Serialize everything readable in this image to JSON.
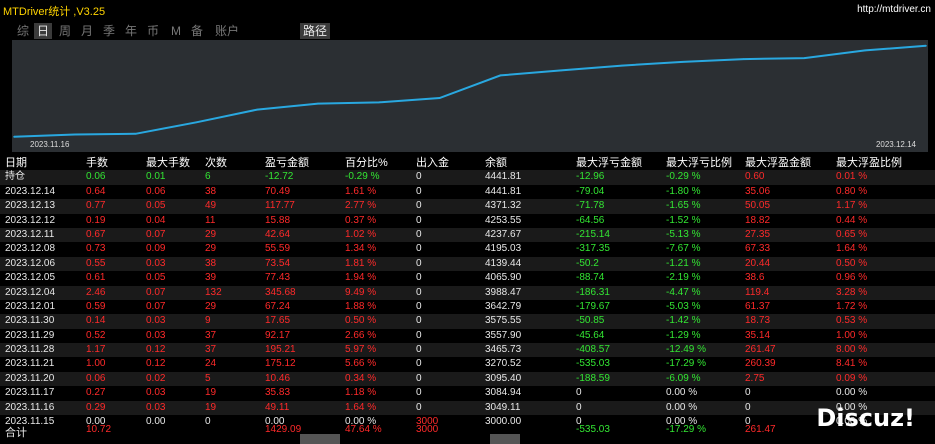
{
  "app": {
    "title": "MTDriver统计 ,V3.25",
    "url": "http://mtdriver.cn"
  },
  "tabs": [
    "综",
    "日",
    "周",
    "月",
    "季",
    "年",
    "币",
    "M",
    "备",
    "账户",
    "路径"
  ],
  "chart": {
    "date_start": "2023.11.16",
    "date_end": "2023.12.14",
    "line_color": "#29a8e0"
  },
  "chart_data": {
    "type": "line",
    "x": [
      "2023.11.16",
      "2023.11.17",
      "2023.11.20",
      "2023.11.21",
      "2023.11.28",
      "2023.11.29",
      "2023.11.30",
      "2023.12.01",
      "2023.12.04",
      "2023.12.05",
      "2023.12.06",
      "2023.12.08",
      "2023.12.11",
      "2023.12.12",
      "2023.12.13",
      "2023.12.14"
    ],
    "series": [
      {
        "values": [
          3049.11,
          3084.94,
          3095.4,
          3270.52,
          3465.73,
          3557.9,
          3575.55,
          3642.79,
          3988.47,
          4065.9,
          4139.44,
          4195.03,
          4237.67,
          4253.55,
          4371.32,
          4441.81
        ]
      }
    ],
    "ylim": [
      3000,
      4500
    ],
    "grid": false
  },
  "headers": [
    "日期",
    "手数",
    "最大手数",
    "次数",
    "盈亏金额",
    "百分比%",
    "出入金",
    "余额",
    "最大浮亏金额",
    "最大浮亏比例",
    "最大浮盈金额",
    "最大浮盈比例"
  ],
  "holding": [
    "持仓",
    "0.06",
    "0.01",
    "6",
    "-12.72",
    "-0.29 %",
    "0",
    "4441.81",
    "-12.96",
    "-0.29 %",
    "0.60",
    "0.01 %"
  ],
  "rows": [
    [
      "2023.12.14",
      "0.64",
      "0.06",
      "38",
      "70.49",
      "1.61 %",
      "0",
      "4441.81",
      "-79.04",
      "-1.80 %",
      "35.06",
      "0.80 %"
    ],
    [
      "2023.12.13",
      "0.77",
      "0.05",
      "49",
      "117.77",
      "2.77 %",
      "0",
      "4371.32",
      "-71.78",
      "-1.65 %",
      "50.05",
      "1.17 %"
    ],
    [
      "2023.12.12",
      "0.19",
      "0.04",
      "11",
      "15.88",
      "0.37 %",
      "0",
      "4253.55",
      "-64.56",
      "-1.52 %",
      "18.82",
      "0.44 %"
    ],
    [
      "2023.12.11",
      "0.67",
      "0.07",
      "29",
      "42.64",
      "1.02 %",
      "0",
      "4237.67",
      "-215.14",
      "-5.13 %",
      "27.35",
      "0.65 %"
    ],
    [
      "2023.12.08",
      "0.73",
      "0.09",
      "29",
      "55.59",
      "1.34 %",
      "0",
      "4195.03",
      "-317.35",
      "-7.67 %",
      "67.33",
      "1.64 %"
    ],
    [
      "2023.12.06",
      "0.55",
      "0.03",
      "38",
      "73.54",
      "1.81 %",
      "0",
      "4139.44",
      "-50.2",
      "-1.21 %",
      "20.44",
      "0.50 %"
    ],
    [
      "2023.12.05",
      "0.61",
      "0.05",
      "39",
      "77.43",
      "1.94 %",
      "0",
      "4065.90",
      "-88.74",
      "-2.19 %",
      "38.6",
      "0.96 %"
    ],
    [
      "2023.12.04",
      "2.46",
      "0.07",
      "132",
      "345.68",
      "9.49 %",
      "0",
      "3988.47",
      "-186.31",
      "-4.47 %",
      "119.4",
      "3.28 %"
    ],
    [
      "2023.12.01",
      "0.59",
      "0.07",
      "29",
      "67.24",
      "1.88 %",
      "0",
      "3642.79",
      "-179.67",
      "-5.03 %",
      "61.37",
      "1.72 %"
    ],
    [
      "2023.11.30",
      "0.14",
      "0.03",
      "9",
      "17.65",
      "0.50 %",
      "0",
      "3575.55",
      "-50.85",
      "-1.42 %",
      "18.73",
      "0.53 %"
    ],
    [
      "2023.11.29",
      "0.52",
      "0.03",
      "37",
      "92.17",
      "2.66 %",
      "0",
      "3557.90",
      "-45.64",
      "-1.29 %",
      "35.14",
      "1.00 %"
    ],
    [
      "2023.11.28",
      "1.17",
      "0.12",
      "37",
      "195.21",
      "5.97 %",
      "0",
      "3465.73",
      "-408.57",
      "-12.49 %",
      "261.47",
      "8.00 %"
    ],
    [
      "2023.11.21",
      "1.00",
      "0.12",
      "24",
      "175.12",
      "5.66 %",
      "0",
      "3270.52",
      "-535.03",
      "-17.29 %",
      "260.39",
      "8.41 %"
    ],
    [
      "2023.11.20",
      "0.06",
      "0.02",
      "5",
      "10.46",
      "0.34 %",
      "0",
      "3095.40",
      "-188.59",
      "-6.09 %",
      "2.75",
      "0.09 %"
    ],
    [
      "2023.11.17",
      "0.27",
      "0.03",
      "19",
      "35.83",
      "1.18 %",
      "0",
      "3084.94",
      "0",
      "0.00 %",
      "0",
      "0.00 %"
    ],
    [
      "2023.11.16",
      "0.29",
      "0.03",
      "19",
      "49.11",
      "1.64 %",
      "0",
      "3049.11",
      "0",
      "0.00 %",
      "0",
      "0.00 %"
    ],
    [
      "2023.11.15",
      "0.00",
      "0.00",
      "0",
      "0.00",
      "0.00 %",
      "3000",
      "3000.00",
      "0",
      "0.00 %",
      "0",
      "0.00 %"
    ]
  ],
  "total": [
    "合计",
    "10.72",
    "",
    "",
    "1429.09",
    "47.64 %",
    "3000",
    "",
    "-535.03",
    "-17.29 %",
    "261.47",
    ""
  ],
  "watermark": "Discuz!"
}
